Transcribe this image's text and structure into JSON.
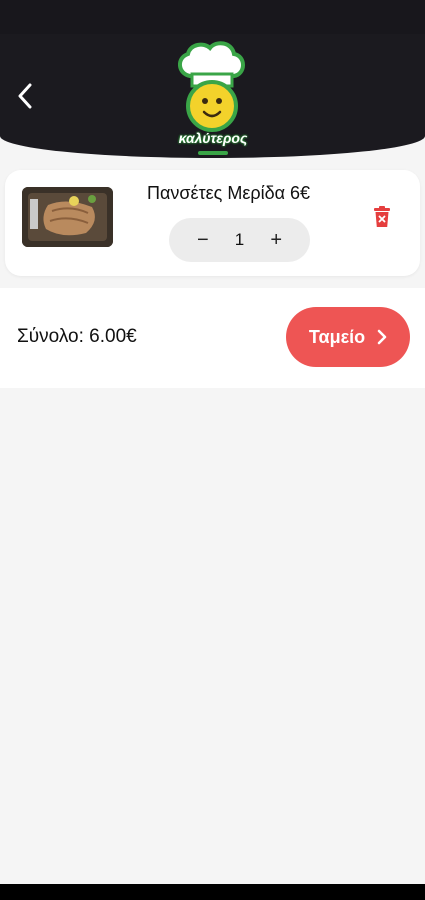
{
  "brand": {
    "name": "καλύτερος"
  },
  "cart": {
    "items": [
      {
        "name": "Πανσέτες Μερίδα 6€",
        "quantity": "1"
      }
    ]
  },
  "summary": {
    "total": "Σύνολο: 6.00€",
    "checkout_label": "Ταμείο"
  },
  "colors": {
    "accent": "#ee5554",
    "header_bg": "#1b1a1f",
    "delete_icon": "#e53e3e",
    "brand_green": "#3aa547",
    "brand_yellow": "#f3d22b"
  },
  "icons": {
    "back": "chevron-left-icon",
    "delete": "trash-icon",
    "checkout": "chevron-right-icon"
  }
}
